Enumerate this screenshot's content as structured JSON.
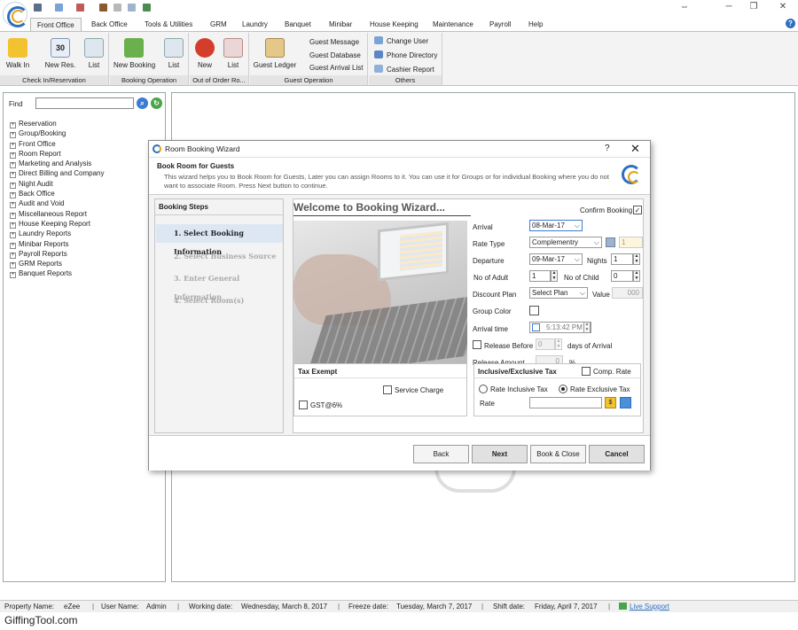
{
  "menu": {
    "tabs": [
      "Front Office",
      "Back Office",
      "Tools & Utilities",
      "GRM",
      "Laundry",
      "Banquet",
      "Minibar",
      "House Keeping",
      "Maintenance",
      "Payroll",
      "Help"
    ]
  },
  "window": {
    "restore_icon": "⇔",
    "minimize": "─",
    "maximize": "❐",
    "close": "✕"
  },
  "ribbon": {
    "groups": {
      "checkin": "Check In/Reservation",
      "booking": "Booking Operation",
      "ooo": "Out of Order Ro...",
      "guest": "Guest Operation",
      "others": "Others"
    },
    "buttons": {
      "walk_in": "Walk In",
      "new_res": "New Res.",
      "new_res_badge": "30",
      "list1": "List",
      "new_booking": "New Booking",
      "list2": "List",
      "new_ooo": "New",
      "list3": "List",
      "guest_ledger": "Guest Ledger",
      "guest_message": "Guest Message",
      "guest_database": "Guest Database",
      "guest_arrival_list": "Guest Arrival List",
      "change_user": "Change User",
      "phone_directory": "Phone Directory",
      "cashier_report": "Cashier Report"
    }
  },
  "sidebar": {
    "find_label": "Find",
    "tree": [
      "Reservation",
      "Group/Booking",
      "Front Office",
      "Room Report",
      "Marketing and Analysis",
      "Direct Billing and Company",
      "Night Audit",
      "Back Office",
      "Audit and Void",
      "Miscellaneous Report",
      "House Keeping Report",
      "Laundry Reports",
      "Minibar Reports",
      "Payroll Reports",
      "GRM Reports",
      "Banquet Reports"
    ]
  },
  "dialog": {
    "title": "Room Booking Wizard",
    "help": "?",
    "close": "✕",
    "header_title": "Book Room for Guests",
    "header_desc": "This wizard helps you to Book Room for Guests, Later you can assign Rooms to it. You can use it for Groups or for individual Booking where you do not want to associate Room. Press Next button to continue.",
    "steps_title": "Booking Steps",
    "steps": [
      "1.  Select Booking Information",
      "2.  Select Business Source",
      "3.  Enter General Information",
      "4.  Select Room(s)"
    ],
    "welcome": "Welcome to Booking Wizard...",
    "confirm_booking": "Confirm Booking",
    "fields": {
      "arrival_label": "Arrival",
      "arrival_value": "08-Mar-17",
      "rate_type_label": "Rate Type",
      "rate_type_value": "Complementry",
      "rate_type_count": "1",
      "departure_label": "Departure",
      "departure_value": "09-Mar-17",
      "nights_label": "Nights",
      "nights_value": "1",
      "adult_label": "No of Adult",
      "adult_value": "1",
      "child_label": "No of Child",
      "child_value": "0",
      "discount_label": "Discount Plan",
      "discount_value": "Select Plan",
      "value_label": "Value",
      "value_value": "000",
      "group_color_label": "Group Color",
      "arrival_time_label": "Arrival time",
      "arrival_time_value": "5:13:42 PM",
      "release_before_label": "Release Before",
      "release_before_value": "0",
      "days_of_arrival": "days of Arrival",
      "release_amount_label": "Release Amount",
      "release_amount_value": "0",
      "percent": "%"
    },
    "tax_exempt": {
      "title": "Tax Exempt",
      "service_charge": "Service Charge",
      "gst": "GST@6%"
    },
    "inclusive": {
      "title": "Inclusive/Exclusive Tax",
      "comp_rate": "Comp. Rate",
      "rate_inclusive": "Rate Inclusive Tax",
      "rate_exclusive": "Rate Exclusive Tax",
      "rate_label": "Rate"
    },
    "buttons": {
      "back": "Back",
      "next": "Next",
      "book_close": "Book & Close",
      "cancel": "Cancel"
    }
  },
  "status": {
    "property_label": "Property Name:",
    "property_value": "eZee",
    "user_label": "User Name:",
    "user_value": "Admin",
    "working_label": "Working date:",
    "working_value": "Wednesday, March 8, 2017",
    "freeze_label": "Freeze date:",
    "freeze_value": "Tuesday, March 7, 2017",
    "shift_label": "Shift date:",
    "shift_value": "Friday, April 7, 2017",
    "live_support": "Live Support"
  },
  "watermark": "GiffingTool.com",
  "colors": {
    "accent": "#2f6fbf",
    "brand_gold": "#e0a21c",
    "ribbon_bg": "#f3f3f3",
    "active_step": "#dde7f4"
  }
}
